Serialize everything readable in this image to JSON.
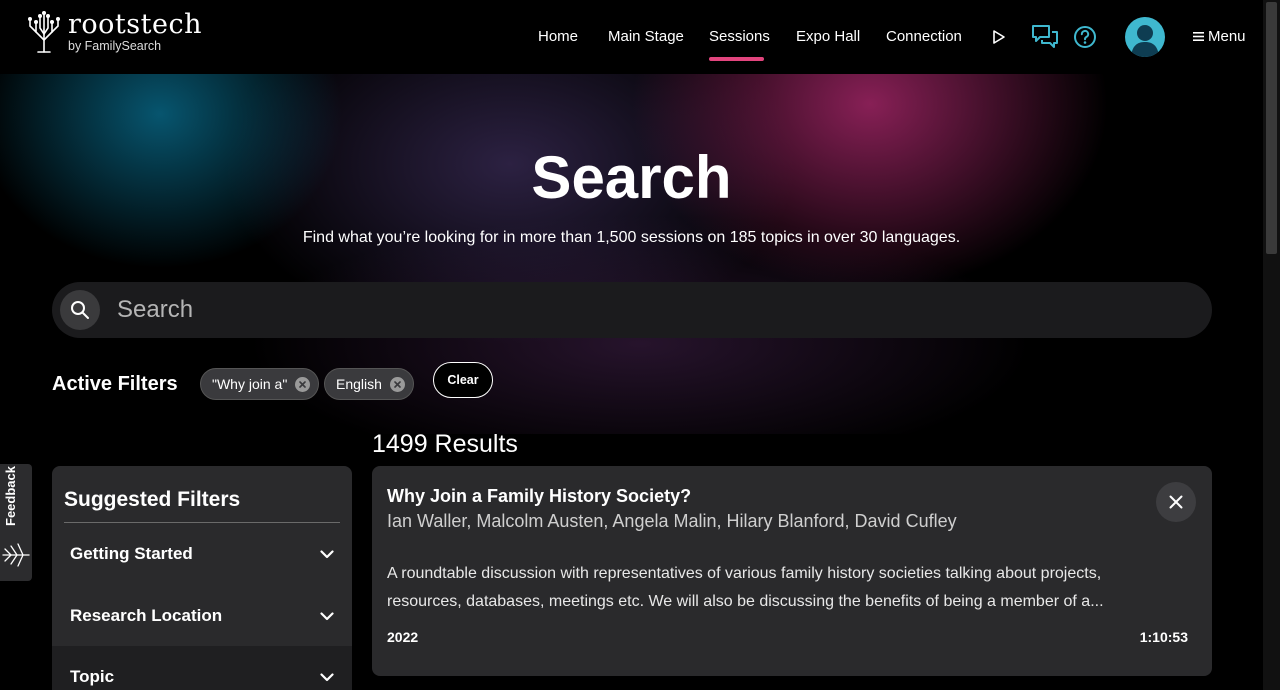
{
  "brand": {
    "name": "rootstech",
    "sub": "by FamilySearch"
  },
  "nav": {
    "items": [
      {
        "label": "Home"
      },
      {
        "label": "Main Stage"
      },
      {
        "label": "Sessions"
      },
      {
        "label": "Expo Hall"
      },
      {
        "label": "Connection"
      }
    ],
    "active": "Sessions",
    "menu_label": "Menu"
  },
  "hero": {
    "title": "Search",
    "subtitle": "Find what you’re looking for in more than 1,500 sessions on 185 topics in over 30 languages."
  },
  "search": {
    "placeholder": "Search",
    "value": ""
  },
  "active_filters": {
    "label": "Active Filters",
    "chips": [
      {
        "label": "\"Why join a\""
      },
      {
        "label": "English"
      }
    ],
    "clear_label": "Clear"
  },
  "feedback": {
    "label": "Feedback"
  },
  "suggested_filters": {
    "title": "Suggested Filters",
    "groups": [
      {
        "label": "Getting Started"
      },
      {
        "label": "Research Location"
      },
      {
        "label": "Topic"
      }
    ]
  },
  "results": {
    "count_label": "1499 Results",
    "items": [
      {
        "title": "Why Join a Family History Society?",
        "speakers": "Ian Waller, Malcolm Austen, Angela Malin, Hilary Blanford, David Cufley",
        "description": "A roundtable discussion with representatives of various family history societies talking about projects, resources, databases, meetings etc. We will also be discussing the benefits of being a member of a...",
        "year": "2022",
        "duration": "1:10:53"
      }
    ]
  },
  "colors": {
    "accent": "#e2457e",
    "icon_blue": "#3fb8cf",
    "card_bg": "#2a2a2c"
  }
}
